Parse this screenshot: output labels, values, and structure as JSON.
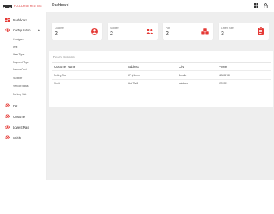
{
  "topbar": {
    "brand": "FULL DRIVE RENTING",
    "title": "Dashboard"
  },
  "sidebar": {
    "items": [
      {
        "label": "Dashboard",
        "icon": "dashboard-icon"
      },
      {
        "label": "Configuration",
        "icon": "gear-icon"
      },
      {
        "label": "Part",
        "icon": "gear-icon"
      },
      {
        "label": "Customer",
        "icon": "gear-icon"
      },
      {
        "label": "Lowest Rate",
        "icon": "gear-icon"
      },
      {
        "label": "Article",
        "icon": "gear-icon"
      }
    ],
    "config_subitems": [
      "Configure",
      "Unit",
      "User Type",
      "Payment Type",
      "Labour Cost",
      "Supplier",
      "Vendor Status",
      "Parking Slot"
    ]
  },
  "cards": [
    {
      "label": "Customer",
      "value": "2",
      "icon": "user-circle-icon"
    },
    {
      "label": "Supplier",
      "value": "2",
      "icon": "users-icon"
    },
    {
      "label": "Part",
      "value": "2",
      "icon": "cubes-icon"
    },
    {
      "label": "Lowest Rate",
      "value": "3",
      "icon": "clipboard-icon"
    }
  ],
  "recent": {
    "title": "Recent Customer",
    "columns": [
      "Customer Name",
      "Address",
      "City",
      "Phone"
    ],
    "rows": [
      [
        "Peking Gus",
        "67 ghtldrdm",
        "Brasilia",
        "123456789"
      ],
      [
        "Shriitt",
        "blot 7Ad6",
        "sakdsers",
        "9999999"
      ]
    ]
  },
  "colors": {
    "accent": "#e53935",
    "main_bg": "#eeeeee"
  }
}
